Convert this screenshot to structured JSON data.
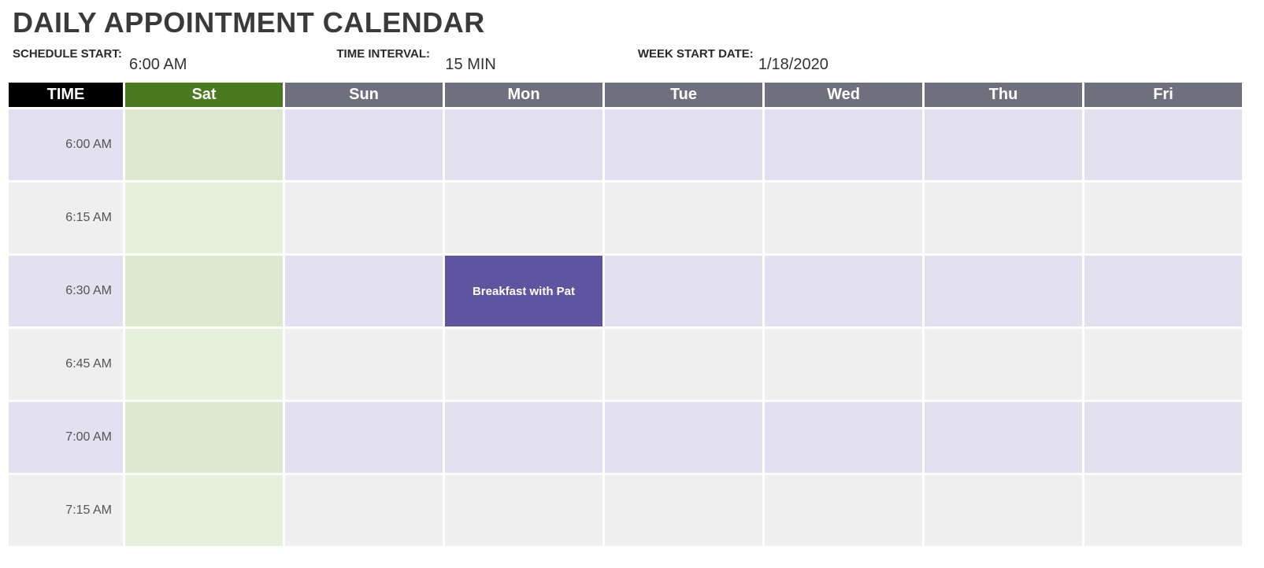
{
  "title": "DAILY APPOINTMENT CALENDAR",
  "meta": {
    "schedule_start_label": "SCHEDULE START:",
    "schedule_start_value": "6:00 AM",
    "time_interval_label": "TIME INTERVAL:",
    "time_interval_value": "15 MIN",
    "week_start_label": "WEEK START DATE:",
    "week_start_value": "1/18/2020"
  },
  "headers": {
    "time": "TIME",
    "days": [
      "Sat",
      "Sun",
      "Mon",
      "Tue",
      "Wed",
      "Thu",
      "Fri"
    ]
  },
  "rows": [
    {
      "time": "6:00 AM",
      "cells": [
        "",
        "",
        "",
        "",
        "",
        "",
        ""
      ]
    },
    {
      "time": "6:15 AM",
      "cells": [
        "",
        "",
        "",
        "",
        "",
        "",
        ""
      ]
    },
    {
      "time": "6:30 AM",
      "cells": [
        "",
        "",
        "Breakfast with Pat",
        "",
        "",
        "",
        ""
      ]
    },
    {
      "time": "6:45 AM",
      "cells": [
        "",
        "",
        "",
        "",
        "",
        "",
        ""
      ]
    },
    {
      "time": "7:00 AM",
      "cells": [
        "",
        "",
        "",
        "",
        "",
        "",
        ""
      ]
    },
    {
      "time": "7:15 AM",
      "cells": [
        "",
        "",
        "",
        "",
        "",
        "",
        ""
      ]
    }
  ]
}
